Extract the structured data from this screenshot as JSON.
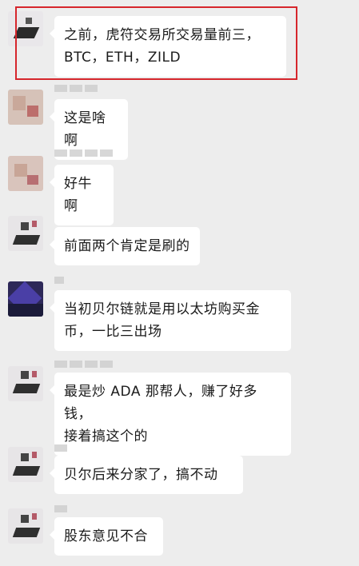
{
  "messages": [
    {
      "text": "之前，虎符交易所交易量前三，\nBTC，ETH，ZILD"
    },
    {
      "text": "这是啥啊"
    },
    {
      "text": "好牛啊"
    },
    {
      "text": "前面两个肯定是刷的"
    },
    {
      "text": "当初贝尔链就是用以太坊购买金\n币，一比三出场"
    },
    {
      "text": "最是炒 ADA 那帮人，赚了好多钱，\n接着搞这个的"
    },
    {
      "text": "贝尔后来分家了，搞不动"
    },
    {
      "text": "股东意见不合"
    }
  ],
  "colors": {
    "background": "#ededed",
    "bubble": "#ffffff",
    "highlight_border": "#d6262c"
  }
}
